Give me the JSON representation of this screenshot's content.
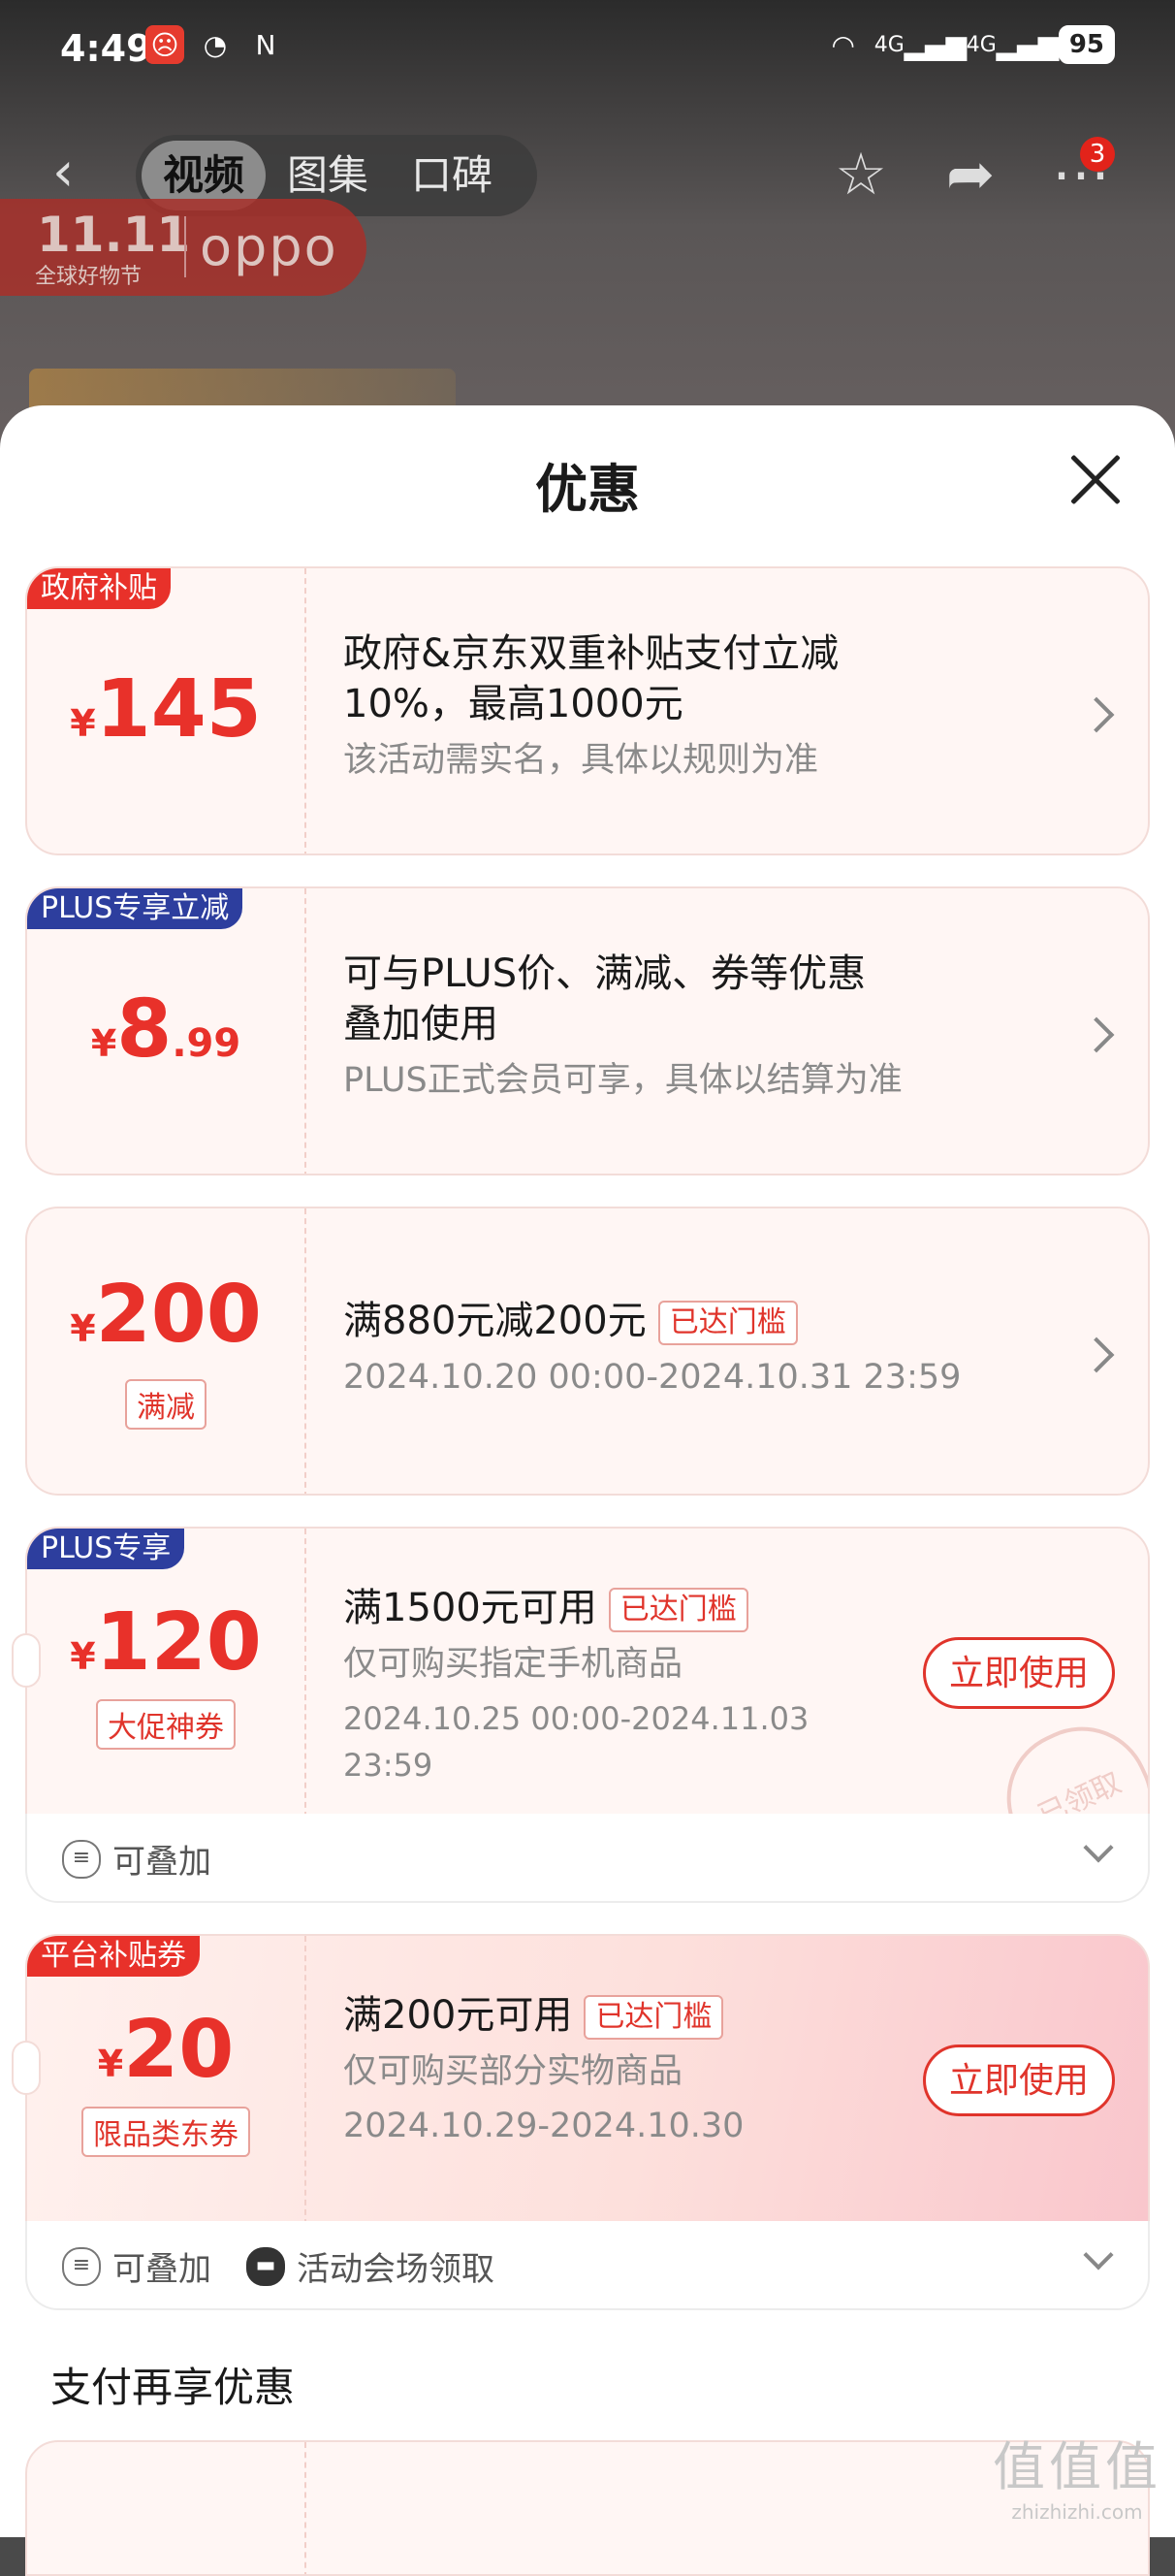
{
  "status_bar": {
    "time": "4:49",
    "network": "4G",
    "battery": "95"
  },
  "nav": {
    "tabs": [
      "视频",
      "图集",
      "口碑"
    ],
    "active_tab": "视频",
    "message_badge": "3"
  },
  "promo_banner": {
    "event": "11.11",
    "event_sub": "全球好物节",
    "brand": "oppo"
  },
  "sheet": {
    "title": "优惠",
    "coupons": [
      {
        "tag": "政府补贴",
        "currency": "¥",
        "amount": "145",
        "line1": "政府&京东双重补贴支付立减",
        "line2": "10%，最高1000元",
        "note": "该活动需实名，具体以规则为准"
      },
      {
        "tag": "PLUS专享立减",
        "currency": "¥",
        "amount": "8",
        "amount_decimal": ".99",
        "line1": "可与PLUS价、满减、券等优惠",
        "line2": "叠加使用",
        "note": "PLUS正式会员可享，具体以结算为准"
      },
      {
        "currency": "¥",
        "amount": "200",
        "label": "满减",
        "main": "满880元减200元",
        "status": "已达门槛",
        "period": "2024.10.20 00:00-2024.10.31 23:59"
      },
      {
        "tag": "PLUS专享",
        "currency": "¥",
        "amount": "120",
        "label": "大促神券",
        "main": "满1500元可用",
        "status": "已达门槛",
        "scope": "仅可购买指定手机商品",
        "period": "2024.10.25 00:00-2024.11.03 23:59",
        "button": "立即使用",
        "stamp": "已领取",
        "footer_stackable": "可叠加"
      },
      {
        "tag": "平台补贴券",
        "currency": "¥",
        "amount": "20",
        "label": "限品类东券",
        "main": "满200元可用",
        "status": "已达门槛",
        "scope": "仅可购买部分实物商品",
        "period": "2024.10.29-2024.10.30",
        "button": "立即使用",
        "footer_stackable": "可叠加",
        "footer_source": "活动会场领取"
      }
    ],
    "section_pay": "支付再享优惠"
  },
  "watermark": {
    "logo": "值值值",
    "domain": "zhizhizhi.com"
  },
  "colors": {
    "accent_red": "#e8312a",
    "plus_blue": "#2d3e9e",
    "card_bg": "#fff6f4"
  }
}
